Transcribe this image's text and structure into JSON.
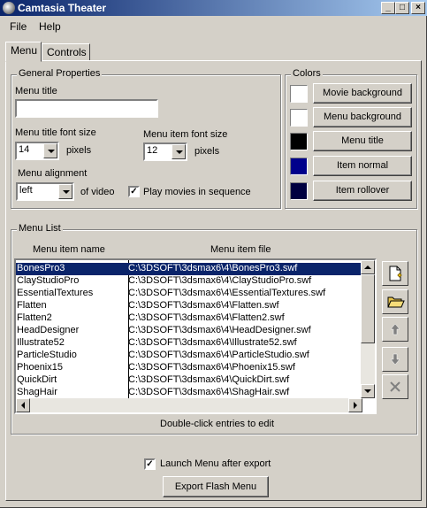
{
  "window": {
    "title": "Camtasia Theater",
    "controls": [
      "_",
      "□",
      "×"
    ]
  },
  "menubar": {
    "items": [
      "File",
      "Help"
    ]
  },
  "tabs": [
    "Menu",
    "Controls"
  ],
  "general": {
    "legend": "General Properties",
    "menu_title_label": "Menu title",
    "menu_title_value": "",
    "title_font_label": "Menu title font size",
    "title_font_value": "14",
    "title_font_unit": "pixels",
    "item_font_label": "Menu item font size",
    "item_font_value": "12",
    "item_font_unit": "pixels",
    "alignment_label": "Menu alignment",
    "alignment_value": "left",
    "alignment_suffix": "of video",
    "play_sequence_label": "Play movies in sequence",
    "play_sequence_checked": true
  },
  "colors": {
    "legend": "Colors",
    "items": [
      {
        "label": "Movie background",
        "color": "#ffffff"
      },
      {
        "label": "Menu background",
        "color": "#ffffff"
      },
      {
        "label": "Menu title",
        "color": "#000000"
      },
      {
        "label": "Item normal",
        "color": "#00008b"
      },
      {
        "label": "Item rollover",
        "color": "#000040"
      }
    ]
  },
  "menu_list": {
    "legend": "Menu List",
    "col_name": "Menu item name",
    "col_file": "Menu item file",
    "hint": "Double-click entries to edit",
    "rows": [
      {
        "name": "BonesPro3",
        "file": "C:\\3DSOFT\\3dsmax6\\4\\BonesPro3.swf",
        "selected": true
      },
      {
        "name": "ClayStudioPro",
        "file": "C:\\3DSOFT\\3dsmax6\\4\\ClayStudioPro.swf"
      },
      {
        "name": "EssentialTextures",
        "file": "C:\\3DSOFT\\3dsmax6\\4\\EssentialTextures.swf"
      },
      {
        "name": "Flatten",
        "file": "C:\\3DSOFT\\3dsmax6\\4\\Flatten.swf"
      },
      {
        "name": "Flatten2",
        "file": "C:\\3DSOFT\\3dsmax6\\4\\Flatten2.swf"
      },
      {
        "name": "HeadDesigner",
        "file": "C:\\3DSOFT\\3dsmax6\\4\\HeadDesigner.swf"
      },
      {
        "name": "Illustrate52",
        "file": "C:\\3DSOFT\\3dsmax6\\4\\Illustrate52.swf"
      },
      {
        "name": "ParticleStudio",
        "file": "C:\\3DSOFT\\3dsmax6\\4\\ParticleStudio.swf"
      },
      {
        "name": "Phoenix15",
        "file": "C:\\3DSOFT\\3dsmax6\\4\\Phoenix15.swf"
      },
      {
        "name": "QuickDirt",
        "file": "C:\\3DSOFT\\3dsmax6\\4\\QuickDirt.swf"
      },
      {
        "name": "ShagHair",
        "file": "C:\\3DSOFT\\3dsmax6\\4\\ShagHair.swf"
      }
    ],
    "side_icons": [
      "new-item-icon",
      "open-folder-icon",
      "move-up-icon",
      "move-down-icon",
      "delete-icon"
    ]
  },
  "footer": {
    "launch_label": "Launch Menu after export",
    "launch_checked": true,
    "export_label": "Export Flash Menu"
  }
}
